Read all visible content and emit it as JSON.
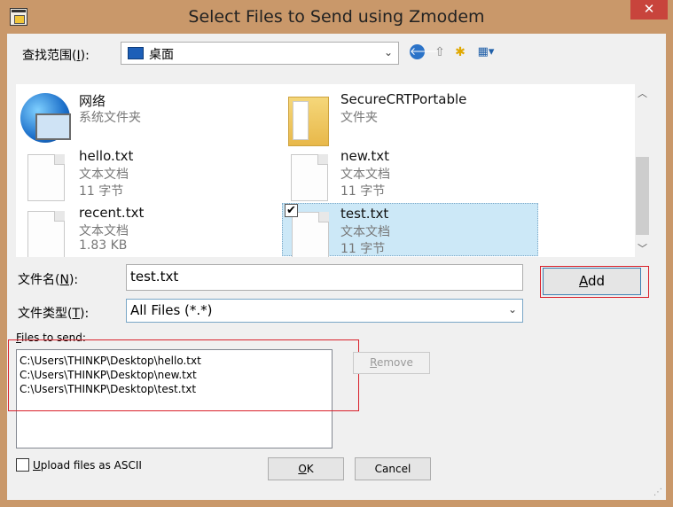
{
  "window": {
    "title": "Select Files to Send using Zmodem",
    "close_glyph": "✕",
    "close_color": "#c8443c"
  },
  "lookin": {
    "label_pre": "查找范围(",
    "label_key": "I",
    "label_post": "):",
    "value": "桌面",
    "arrow": "⌄"
  },
  "toolbar": {
    "back_icon": "🡐",
    "up_icon": "⇧",
    "newfolder_icon": "✱",
    "views_icon": "▦▾"
  },
  "files": [
    {
      "name": "网络",
      "type": "系统文件夹",
      "size": "",
      "icon": "network-icon"
    },
    {
      "name": "SecureCRTPortable",
      "type": "文件夹",
      "size": "",
      "icon": "folder-icon"
    },
    {
      "name": "hello.txt",
      "type": "文本文档",
      "size": "11 字节",
      "icon": "text-file-icon"
    },
    {
      "name": "new.txt",
      "type": "文本文档",
      "size": "11 字节",
      "icon": "text-file-icon"
    },
    {
      "name": "recent.txt",
      "type": "文本文档",
      "size": "1.83 KB",
      "icon": "text-file-icon"
    },
    {
      "name": "test.txt",
      "type": "文本文档",
      "size": "11 字节",
      "icon": "text-file-icon",
      "selected": true
    }
  ],
  "scroll": {
    "up": "︿",
    "down": "﹀"
  },
  "filename": {
    "label_pre": "文件名(",
    "label_key": "N",
    "label_post": "):",
    "value": "test.txt"
  },
  "filetype": {
    "label_pre": "文件类型(",
    "label_key": "T",
    "label_post": "):",
    "value": "All Files (*.*)",
    "arrow": "⌄"
  },
  "add_button": {
    "key": "A",
    "rest": "dd"
  },
  "files_to_send": {
    "label_key": "F",
    "label_rest": "iles to send:",
    "items": [
      "C:\\Users\\THINKP\\Desktop\\hello.txt",
      "C:\\Users\\THINKP\\Desktop\\new.txt",
      "C:\\Users\\THINKP\\Desktop\\test.txt"
    ]
  },
  "remove_button": {
    "key": "R",
    "rest": "emove"
  },
  "ascii": {
    "key": "U",
    "rest": "pload files as ASCII",
    "checked": false
  },
  "ok_button": {
    "key": "O",
    "rest": "K"
  },
  "cancel_button": {
    "label": "Cancel"
  },
  "check_glyph": "✔",
  "grip": "⋰",
  "highlight_color": "#d9202a"
}
